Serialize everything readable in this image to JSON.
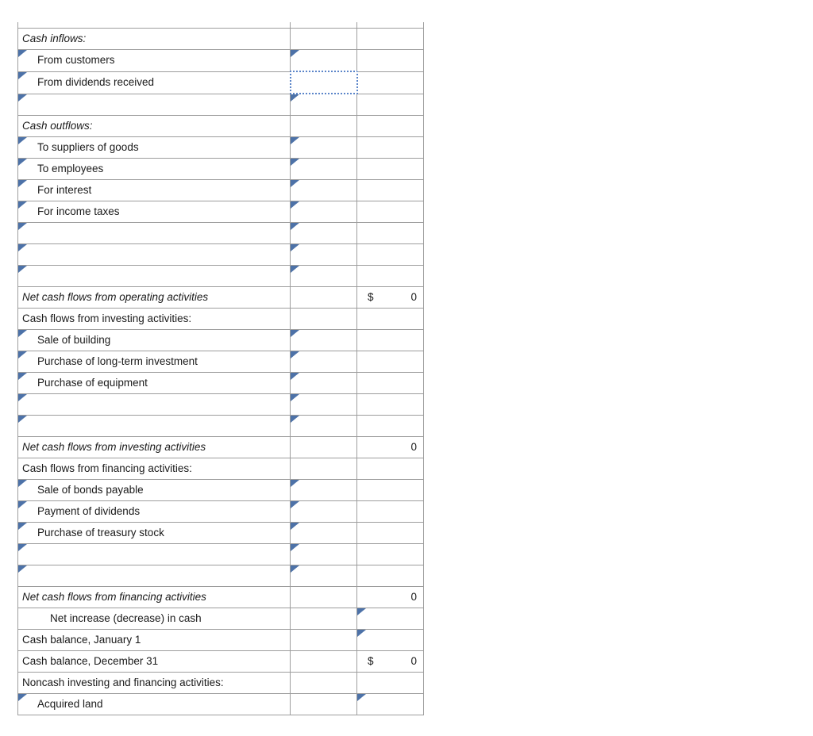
{
  "document": {
    "kind": "statement-of-cash-flows-worksheet",
    "clipped_top_row_text": ""
  },
  "colors": {
    "input_border": "#4d72a8",
    "focus_border": "#5b85c9",
    "grid": "#9d9d9d",
    "rule": "#000000",
    "text": "#1a1a1a"
  },
  "currency_symbol": "$",
  "rows": [
    {
      "id": "cash-inflows-header",
      "label": "Cash inflows:",
      "style": "italic",
      "indent": 0,
      "mid": "",
      "right": ""
    },
    {
      "id": "from-customers",
      "label": "From customers",
      "style": "plain",
      "indent": 1,
      "mid": "",
      "right": ""
    },
    {
      "id": "from-dividends-received",
      "label": "From dividends received",
      "style": "plain",
      "indent": 1,
      "mid": "",
      "right": ""
    },
    {
      "id": "operating-inflow-blank-1",
      "label": "",
      "style": "plain",
      "indent": 1,
      "mid": "",
      "right": ""
    },
    {
      "id": "cash-outflows-header",
      "label": "Cash outflows:",
      "style": "italic",
      "indent": 0,
      "mid": "",
      "right": ""
    },
    {
      "id": "to-suppliers-of-goods",
      "label": "To suppliers of goods",
      "style": "plain",
      "indent": 1,
      "mid": "",
      "right": ""
    },
    {
      "id": "to-employees",
      "label": "To employees",
      "style": "plain",
      "indent": 1,
      "mid": "",
      "right": ""
    },
    {
      "id": "for-interest",
      "label": "For interest",
      "style": "plain",
      "indent": 1,
      "mid": "",
      "right": ""
    },
    {
      "id": "for-income-taxes",
      "label": "For income taxes",
      "style": "plain",
      "indent": 1,
      "mid": "",
      "right": ""
    },
    {
      "id": "operating-blank-2",
      "label": "",
      "style": "plain",
      "indent": 1,
      "mid": "",
      "right": ""
    },
    {
      "id": "operating-blank-3",
      "label": "",
      "style": "plain",
      "indent": 1,
      "mid": "",
      "right": ""
    },
    {
      "id": "operating-blank-4",
      "label": "",
      "style": "plain",
      "indent": 1,
      "mid": "",
      "right": ""
    },
    {
      "id": "net-operating-total",
      "label": "Net cash flows from operating activities",
      "style": "italic",
      "indent": 0,
      "mid": "",
      "right": "0",
      "right_currency": "$"
    },
    {
      "id": "investing-header",
      "label": "Cash flows from investing activities:",
      "style": "plain",
      "indent": 0,
      "mid": "",
      "right": ""
    },
    {
      "id": "sale-of-building",
      "label": "Sale of building",
      "style": "plain",
      "indent": 1,
      "mid": "",
      "right": ""
    },
    {
      "id": "purchase-long-term-invest",
      "label": "Purchase of long-term investment",
      "style": "plain",
      "indent": 1,
      "mid": "",
      "right": ""
    },
    {
      "id": "purchase-of-equipment",
      "label": "Purchase of equipment",
      "style": "plain",
      "indent": 1,
      "mid": "",
      "right": ""
    },
    {
      "id": "investing-blank-1",
      "label": "",
      "style": "plain",
      "indent": 1,
      "mid": "",
      "right": ""
    },
    {
      "id": "investing-blank-2",
      "label": "",
      "style": "plain",
      "indent": 1,
      "mid": "",
      "right": ""
    },
    {
      "id": "net-investing-total",
      "label": "Net cash flows from investing activities",
      "style": "italic",
      "indent": 0,
      "mid": "",
      "right": "0"
    },
    {
      "id": "financing-header",
      "label": "Cash flows from financing activities:",
      "style": "plain",
      "indent": 0,
      "mid": "",
      "right": ""
    },
    {
      "id": "sale-of-bonds-payable",
      "label": "Sale of bonds payable",
      "style": "plain",
      "indent": 1,
      "mid": "",
      "right": ""
    },
    {
      "id": "payment-of-dividends",
      "label": "Payment of dividends",
      "style": "plain",
      "indent": 1,
      "mid": "",
      "right": ""
    },
    {
      "id": "purchase-of-treasury-stock",
      "label": "Purchase of treasury stock",
      "style": "plain",
      "indent": 1,
      "mid": "",
      "right": ""
    },
    {
      "id": "financing-blank-1",
      "label": "",
      "style": "plain",
      "indent": 1,
      "mid": "",
      "right": ""
    },
    {
      "id": "financing-blank-2",
      "label": "",
      "style": "plain",
      "indent": 1,
      "mid": "",
      "right": ""
    },
    {
      "id": "net-financing-total",
      "label": "Net cash flows from financing activities",
      "style": "italic",
      "indent": 0,
      "mid": "",
      "right": "0"
    },
    {
      "id": "net-increase-decrease-cash",
      "label": "Net increase (decrease) in cash",
      "style": "plain",
      "indent": 2,
      "mid": "",
      "right": ""
    },
    {
      "id": "cash-balance-january-1",
      "label": "Cash balance, January 1",
      "style": "plain",
      "indent": 0,
      "mid": "",
      "right": ""
    },
    {
      "id": "cash-balance-december-31",
      "label": "Cash balance, December 31",
      "style": "plain",
      "indent": 0,
      "mid": "",
      "right": "0",
      "right_currency": "$"
    },
    {
      "id": "noncash-activities-header",
      "label": "Noncash investing and financing activities:",
      "style": "plain",
      "indent": 0,
      "mid": "",
      "right": ""
    },
    {
      "id": "acquired-land",
      "label": "Acquired land",
      "style": "plain",
      "indent": 1,
      "mid": "",
      "right": ""
    }
  ]
}
